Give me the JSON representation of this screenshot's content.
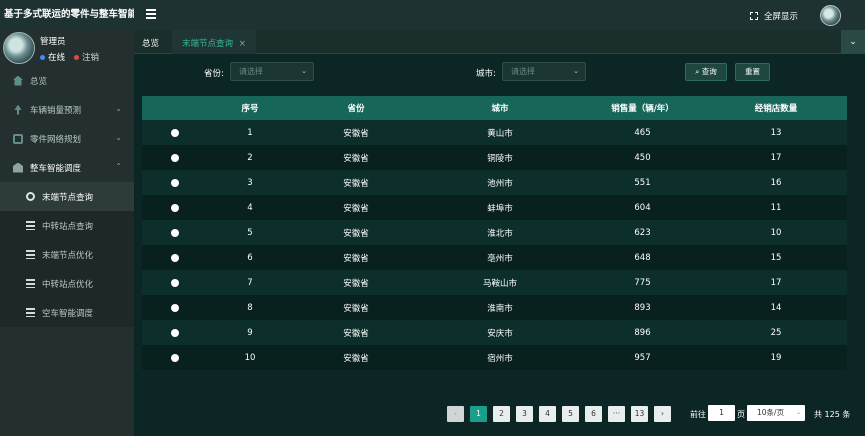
{
  "app": {
    "title": "基于多式联运的零件与整车智能调"
  },
  "user": {
    "name": "管理员",
    "online": "在线",
    "logout": "注销"
  },
  "sidebar": {
    "items": [
      {
        "label": "总览"
      },
      {
        "label": "车辆销量预测"
      },
      {
        "label": "零件网络规划"
      },
      {
        "label": "整车智能调度"
      }
    ],
    "subitems": [
      {
        "label": "末端节点查询"
      },
      {
        "label": "中转站点查询"
      },
      {
        "label": "末端节点优化"
      },
      {
        "label": "中转站点优化"
      },
      {
        "label": "空车智能调度"
      }
    ]
  },
  "topbar": {
    "fullscreen": "全屏显示"
  },
  "tabs": {
    "home": "总览",
    "active": "末端节点查询",
    "close": "×",
    "more": "⌄"
  },
  "filters": {
    "province_label": "省份:",
    "province_placeholder": "请选择",
    "city_label": "城市:",
    "city_placeholder": "请选择",
    "search_button": "查询",
    "reset_button": "重置"
  },
  "table": {
    "headers": [
      "",
      "序号",
      "省份",
      "城市",
      "销售量（辆/年）",
      "经销店数量"
    ],
    "rows": [
      [
        "1",
        "安徽省",
        "黄山市",
        "465",
        "13"
      ],
      [
        "2",
        "安徽省",
        "铜陵市",
        "450",
        "17"
      ],
      [
        "3",
        "安徽省",
        "池州市",
        "551",
        "16"
      ],
      [
        "4",
        "安徽省",
        "蚌埠市",
        "604",
        "11"
      ],
      [
        "5",
        "安徽省",
        "淮北市",
        "623",
        "10"
      ],
      [
        "6",
        "安徽省",
        "亳州市",
        "648",
        "15"
      ],
      [
        "7",
        "安徽省",
        "马鞍山市",
        "775",
        "17"
      ],
      [
        "8",
        "安徽省",
        "淮南市",
        "893",
        "14"
      ],
      [
        "9",
        "安徽省",
        "安庆市",
        "896",
        "25"
      ],
      [
        "10",
        "安徽省",
        "宿州市",
        "957",
        "19"
      ]
    ]
  },
  "pagination": {
    "prev": "‹",
    "pages": [
      "1",
      "2",
      "3",
      "4",
      "5",
      "6",
      "···",
      "13"
    ],
    "next": "›",
    "goto_prefix": "前往",
    "goto_value": "1",
    "goto_suffix": "页",
    "page_size": "10条/页",
    "total": "共 125 条"
  }
}
